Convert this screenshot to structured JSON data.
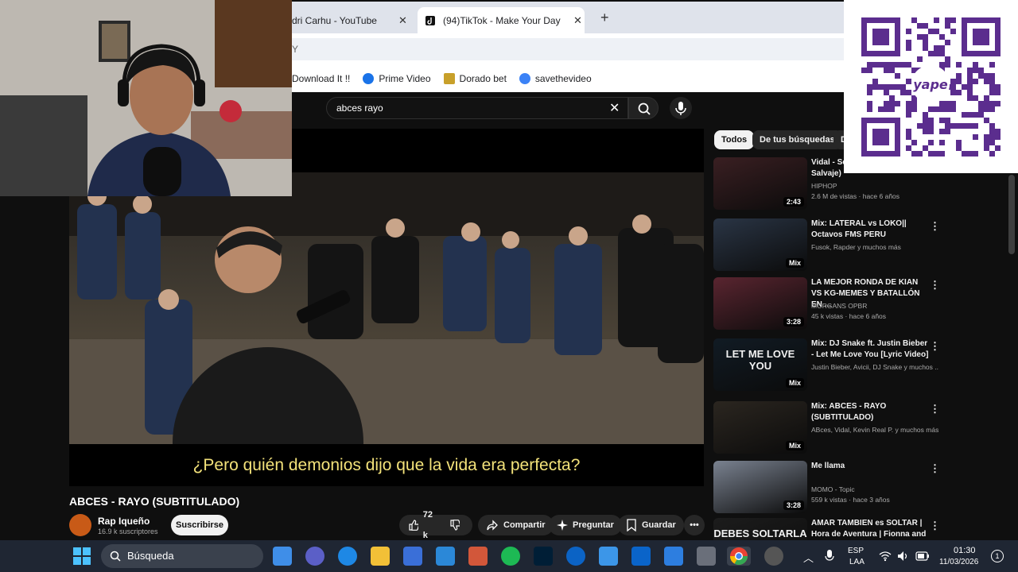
{
  "browser": {
    "tabs": [
      {
        "label": "dri Carhu - YouTube",
        "active": false
      },
      {
        "label": "(94)TikTok - Make Your Day",
        "active": true
      }
    ],
    "new_tab": "+",
    "address_fragment": "Y",
    "bookmarks": [
      {
        "label": "Download It !!",
        "icon_color": "#ffffff"
      },
      {
        "label": "Prime Video",
        "icon_color": "#1a73e8"
      },
      {
        "label": "Dorado bet",
        "icon_color": "#c8a02a"
      },
      {
        "label": "savethevideo",
        "icon_color": "#3b82f6"
      }
    ]
  },
  "youtube": {
    "search_value": "abces rayo",
    "video": {
      "subtitle": "¿Pero quién demonios dijo que la vida era perfecta?",
      "title": "ABCES - RAYO (SUBTITULADO)",
      "channel": "Rap Iqueño",
      "subscribers": "16.9 k suscriptores",
      "subscribe_label": "Suscribirse",
      "likes": "72 k",
      "share_label": "Compartir",
      "ask_label": "Preguntar",
      "save_label": "Guardar"
    },
    "chips": [
      "Todos",
      "De tus búsquedas",
      "D"
    ],
    "recommendations": [
      {
        "title": "Vidal - Se encontrados ( Villa Salvaje)",
        "meta1": "HIPHOP",
        "meta2": "2.6 M de vistas · hace 6 años",
        "badge": "2:43",
        "thumb": "#3a1f22"
      },
      {
        "title": "Mix: LATERAL vs LOKO|| Octavos FMS PERU",
        "meta1": "Fusok, Rapder y muchos más",
        "meta2": "",
        "badge": "Mix",
        "thumb": "#2a3545"
      },
      {
        "title": "LA MEJOR RONDA DE KIAN VS KG-MEMES Y BATALLÓN EN ...",
        "meta1": "MORGANS OPBR",
        "meta2": "45 k vistas · hace 6 años",
        "badge": "3:28",
        "thumb": "#5a2530"
      },
      {
        "title": "Mix: DJ Snake ft. Justin Bieber - Let Me Love You [Lyric Video]",
        "meta1": "Justin Bieber, Avicii, DJ Snake y muchos ...",
        "meta2": "",
        "badge": "Mix",
        "thumb": "#111b24",
        "thumb_text": "LET ME LOVE YOU"
      },
      {
        "title": "Mix: ABCES - RAYO (SUBTITULADO)",
        "meta1": "ABces, Vidal, Kevin Real P. y muchos más",
        "meta2": "",
        "badge": "Mix",
        "thumb": "#2b2620"
      },
      {
        "title": "Me llama",
        "meta1": "MOMO - Topic",
        "meta2": "559 k vistas · hace 3 años",
        "badge": "3:28",
        "thumb": "#7a8290"
      },
      {
        "title": "AMAR TAMBIEN es SOLTAR | Hora de Aventura | Fionna and ...",
        "meta1": "",
        "meta2": "",
        "badge": "",
        "thumb": "#1c1c1c",
        "thumb_text": "DEBES SOLTARLA"
      }
    ]
  },
  "taskbar": {
    "search_label": "Búsqueda",
    "lang_top": "ESP",
    "lang_bottom": "LAA",
    "time": "01:30",
    "date": "11/03/2026",
    "notification_count": "1"
  },
  "qr": {
    "brand": "yape",
    "accent": "#5b2d8e"
  }
}
